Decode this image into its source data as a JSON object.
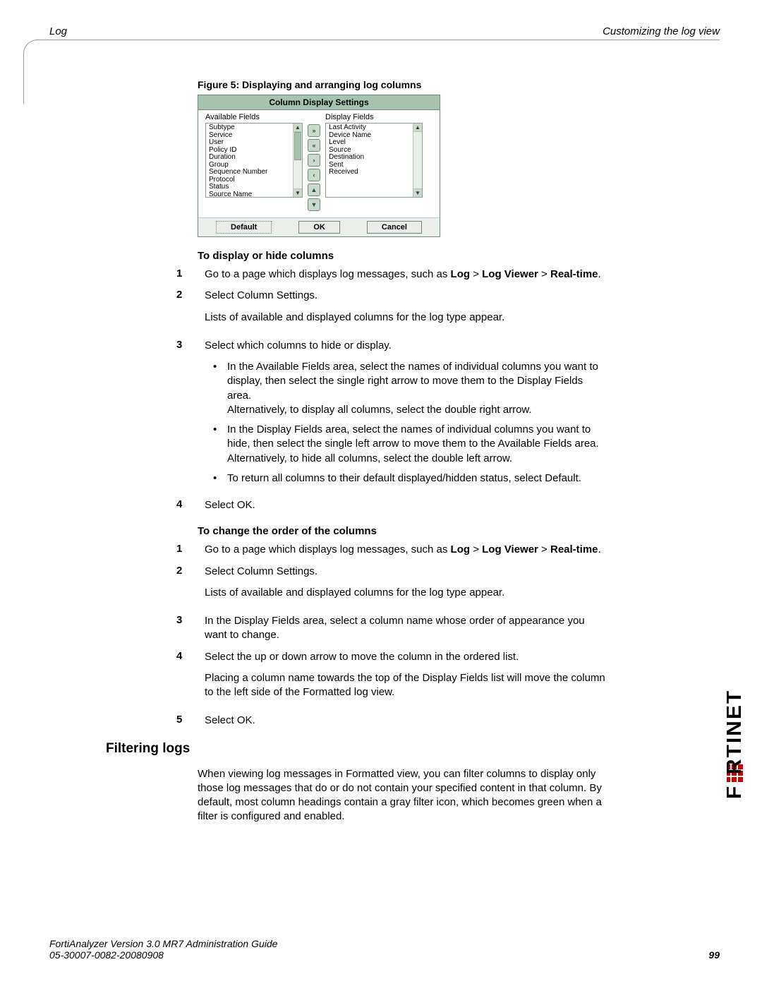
{
  "header": {
    "left": "Log",
    "right": "Customizing the log view"
  },
  "figure": {
    "caption": "Figure 5:   Displaying and arranging log columns"
  },
  "dialog": {
    "title": "Column Display Settings",
    "left_label": "Available Fields",
    "right_label": "Display Fields",
    "available": [
      "Subtype",
      "Service",
      "User",
      "Policy ID",
      "Duration",
      "Group",
      "Sequence Number",
      "Protocol",
      "Status",
      "Source Name"
    ],
    "display": [
      "Last Activity",
      "Device Name",
      "Level",
      "Source",
      "Destination",
      "Sent",
      "Received"
    ],
    "buttons": {
      "default": "Default",
      "ok": "OK",
      "cancel": "Cancel"
    }
  },
  "proc1": {
    "heading": "To display or hide columns",
    "steps": [
      {
        "n": "1",
        "before": "Go to a page which displays log messages, such as ",
        "b1": "Log",
        "sep1": " > ",
        "b2": "Log Viewer",
        "sep2": " > ",
        "b3": "Real-time",
        "tail": "."
      },
      {
        "n": "2",
        "line": "Select Column Settings.",
        "after": "Lists of available and displayed columns for the log type appear."
      },
      {
        "n": "3",
        "line": "Select which columns to hide or display.",
        "bullets": [
          {
            "a": "In the Available Fields area, select the names of individual columns you want to display, then select the single right arrow to move them to the Display Fields area.",
            "b": "Alternatively, to display all columns, select the double right arrow."
          },
          {
            "a": "In the Display Fields area, select the names of individual columns you want to hide, then select the single left arrow to move them to the Available Fields area.",
            "b": "Alternatively, to hide all columns, select the double left arrow."
          },
          {
            "a": "To return all columns to their default displayed/hidden status, select Default."
          }
        ]
      },
      {
        "n": "4",
        "line": "Select OK."
      }
    ]
  },
  "proc2": {
    "heading": "To change the order of the columns",
    "steps": [
      {
        "n": "1",
        "before": "Go to a page which displays log messages, such as ",
        "b1": "Log",
        "sep1": " > ",
        "b2": "Log Viewer",
        "sep2": " > ",
        "b3": "Real-time",
        "tail": "."
      },
      {
        "n": "2",
        "line": "Select Column Settings.",
        "after": "Lists of available and displayed columns for the log type appear."
      },
      {
        "n": "3",
        "line": "In the Display Fields area, select a column name whose order of appearance you want to change."
      },
      {
        "n": "4",
        "line": "Select the up or down arrow to move the column in the ordered list.",
        "after": "Placing a column name towards the top of the Display Fields list will move the column to the left side of the Formatted log view."
      },
      {
        "n": "5",
        "line": "Select OK."
      }
    ]
  },
  "filtering": {
    "heading": "Filtering logs",
    "body": "When viewing log messages in Formatted view, you can filter columns to display only those log messages that do or do not contain your specified content in that column. By default, most column headings contain a gray filter icon, which becomes green when a filter is configured and enabled."
  },
  "footer": {
    "line1": "FortiAnalyzer Version 3.0 MR7 Administration Guide",
    "line2": "05-30007-0082-20080908",
    "page": "99"
  }
}
